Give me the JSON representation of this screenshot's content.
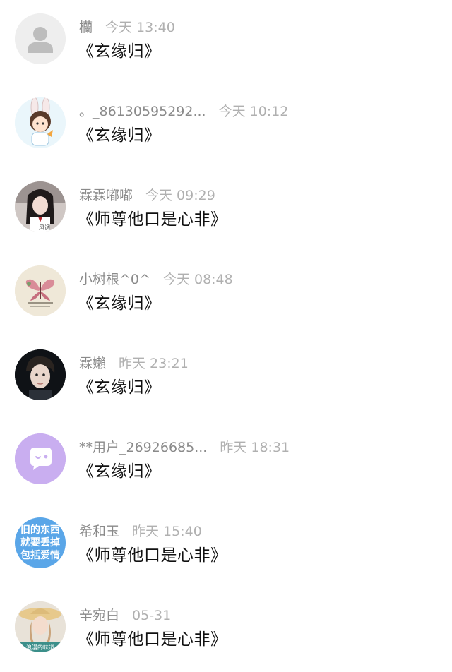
{
  "messages": [
    {
      "name": "欗",
      "time": "今天 13:40",
      "text": "《玄缘归》",
      "avatar": "default-user-icon"
    },
    {
      "name": "。_86130595292...",
      "time": "今天 10:12",
      "text": "《玄缘归》",
      "avatar": "bunny-boy-avatar"
    },
    {
      "name": "霖霖嘟嘟",
      "time": "今天 09:29",
      "text": "《师尊他口是心非》",
      "avatar": "girl-photo-avatar"
    },
    {
      "name": "小树根^0^",
      "time": "今天 08:48",
      "text": "《玄缘归》",
      "avatar": "butterfly-avatar"
    },
    {
      "name": "霖嬾",
      "time": "昨天 23:21",
      "text": "《玄缘归》",
      "avatar": "boy-photo-avatar"
    },
    {
      "name": "**用户_26926685...",
      "time": "昨天 18:31",
      "text": "《玄缘归》",
      "avatar": "chat-bubble-avatar"
    },
    {
      "name": "希和玉",
      "time": "昨天 15:40",
      "text": "《师尊他口是心非》",
      "avatar": "text-avatar",
      "avatar_text": [
        "旧的东西",
        "就要丢掉",
        "包括爱情"
      ]
    },
    {
      "name": "辛宛白",
      "time": "05-31",
      "text": "《师尊他口是心非》",
      "avatar": "woman-hat-avatar"
    }
  ],
  "colors": {
    "name": "#8a8a8a",
    "time": "#b0b0b0",
    "message": "#111111",
    "divider": "#f1f1f1",
    "chat_bubble_bg": "#c9aef0",
    "text_avatar_bg": "#5aa6e8"
  }
}
